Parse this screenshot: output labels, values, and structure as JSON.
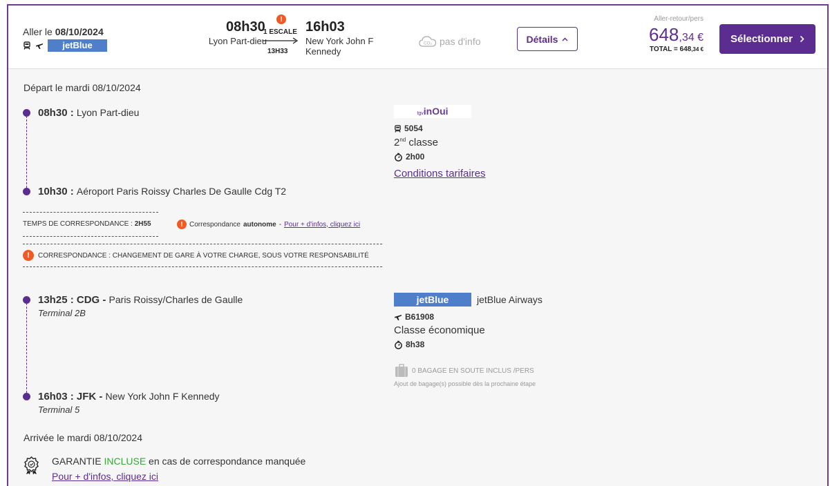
{
  "header": {
    "date_prefix": "Aller le ",
    "date": "08/10/2024",
    "airline_logo_text": "jetBlue",
    "depart_time": "08h30",
    "depart_station": "Lyon Part-dieu",
    "stops_label": "1 ESCALE",
    "stops_duration": "13H33",
    "arrive_time": "16h03",
    "arrive_station_line1": "New York John F",
    "arrive_station_line2": "Kennedy",
    "co2_icon_text": "CO₂",
    "co2_label": "pas d'info",
    "details_button": "Détails",
    "price_label": "Aller-retour/pers",
    "price_main": "648",
    "price_cents": ",34 €",
    "total_label": "TOTAL = 648",
    "total_cents": ",34 €",
    "select_button": "Sélectionner"
  },
  "outbound": {
    "departure_date": "Départ le mardi 08/10/2024",
    "arrival_date": "Arrivée le mardi 08/10/2024"
  },
  "segment1": {
    "start_time": "08h30 :",
    "start_station": "Lyon Part-dieu",
    "end_time": "10h30 :",
    "end_station": "Aéroport Paris Roissy Charles De Gaulle Cdg T2",
    "logo_small": "tgv",
    "logo_text": "inOui",
    "train_number": "5054",
    "class_prefix": "2",
    "class_sup": "nd",
    "class_suffix": " classe",
    "duration": "2h00",
    "conditions_link": "Conditions tarifaires"
  },
  "connection": {
    "time_label": "TEMPS DE CORRESPONDANCE : ",
    "time_value": "2H55",
    "autonomous_prefix": "Correspondance ",
    "autonomous_bold": "autonome",
    "autonomous_sep": " - ",
    "autonomous_link": "Pour + d'infos, cliquez ici",
    "warning": "CORRESPONDANCE : CHANGEMENT DE GARE À VOTRE CHARGE, SOUS VOTRE RESPONSABILITÉ"
  },
  "segment2": {
    "start_time": "13h25 : CDG -",
    "start_station": "Paris Roissy/Charles de Gaulle",
    "start_terminal": "Terminal 2B",
    "end_time": "16h03 : JFK -",
    "end_station": "New York John F Kennedy",
    "end_terminal": "Terminal 5",
    "logo_text": "jetBlue",
    "airline_name": "jetBlue Airways",
    "flight_number": "B61908",
    "cabin_class": "Classe économique",
    "duration": "8h38",
    "baggage": "0 BAGAGE EN SOUTE INCLUS /PERS",
    "baggage_note": "Ajout de bagage(s) possible dès la prochaine étape"
  },
  "guarantee": {
    "prefix": "GARANTIE ",
    "included": "INCLUSE",
    "suffix": " en cas de correspondance manquée",
    "link": "Pour + d'infos, cliquez ici"
  },
  "colors": {
    "brand": "#5c2d91",
    "warning": "#f15a22",
    "included": "#3aa53a",
    "jetblue": "#4f7fcb"
  }
}
